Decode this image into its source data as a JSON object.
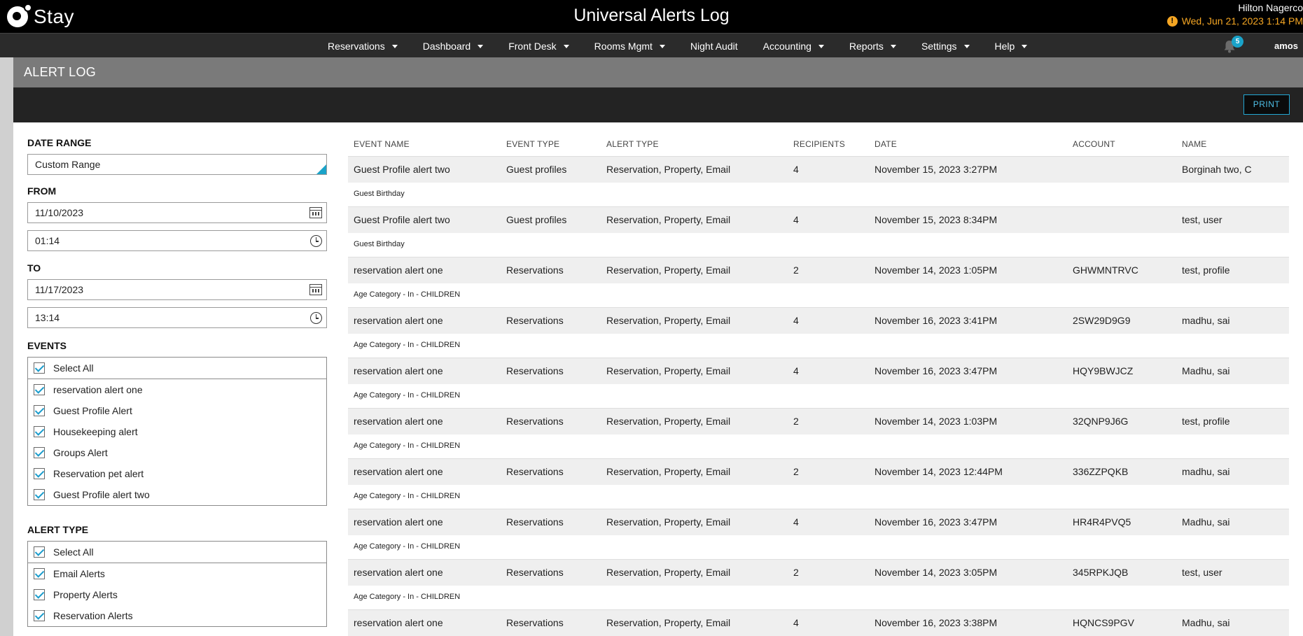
{
  "app": {
    "logo_text": "Stay",
    "title": "Universal Alerts Log",
    "hotel_name": "Hilton Nagerco",
    "datetime": "Wed, Jun 21, 2023 1:14 PM",
    "colors": {
      "accent": "#1aa3c9",
      "warning": "#f5a623"
    }
  },
  "nav": {
    "items": [
      {
        "label": "Reservations",
        "dropdown": true
      },
      {
        "label": "Dashboard",
        "dropdown": true
      },
      {
        "label": "Front Desk",
        "dropdown": true
      },
      {
        "label": "Rooms Mgmt",
        "dropdown": true
      },
      {
        "label": "Night Audit",
        "dropdown": false
      },
      {
        "label": "Accounting",
        "dropdown": true
      },
      {
        "label": "Reports",
        "dropdown": true
      },
      {
        "label": "Settings",
        "dropdown": true
      },
      {
        "label": "Help",
        "dropdown": true
      }
    ],
    "notification_count": "5",
    "user": "amos"
  },
  "page": {
    "title": "ALERT LOG",
    "print_label": "PRINT"
  },
  "filters": {
    "date_range_label": "DATE RANGE",
    "date_range_value": "Custom Range",
    "from_label": "FROM",
    "from_date": "11/10/2023",
    "from_time": "01:14",
    "to_label": "TO",
    "to_date": "11/17/2023",
    "to_time": "13:14",
    "events_label": "EVENTS",
    "events_select_all": "Select All",
    "events": [
      "reservation alert one",
      "Guest Profile Alert",
      "Housekeeping alert",
      "Groups Alert",
      "Reservation pet alert",
      "Guest Profile alert two"
    ],
    "alert_type_label": "ALERT TYPE",
    "alert_type_select_all": "Select All",
    "alert_types": [
      "Email Alerts",
      "Property Alerts",
      "Reservation Alerts"
    ]
  },
  "table": {
    "headers": [
      "EVENT NAME",
      "EVENT TYPE",
      "ALERT TYPE",
      "RECIPIENTS",
      "DATE",
      "ACCOUNT",
      "NAME"
    ],
    "rows": [
      {
        "event_name": "Guest Profile alert two",
        "event_type": "Guest profiles",
        "alert_type": "Reservation, Property, Email",
        "recipients": "4",
        "date": "November 15, 2023 3:27PM",
        "account": "",
        "name": "Borginah two, C",
        "detail": "Guest Birthday"
      },
      {
        "event_name": "Guest Profile alert two",
        "event_type": "Guest profiles",
        "alert_type": "Reservation, Property, Email",
        "recipients": "4",
        "date": "November 15, 2023 8:34PM",
        "account": "",
        "name": "test, user",
        "detail": "Guest Birthday"
      },
      {
        "event_name": "reservation alert one",
        "event_type": "Reservations",
        "alert_type": "Reservation, Property, Email",
        "recipients": "2",
        "date": "November 14, 2023 1:05PM",
        "account": "GHWMNTRVC",
        "name": "test, profile",
        "detail": "Age Category - In - CHILDREN"
      },
      {
        "event_name": "reservation alert one",
        "event_type": "Reservations",
        "alert_type": "Reservation, Property, Email",
        "recipients": "4",
        "date": "November 16, 2023 3:41PM",
        "account": "2SW29D9G9",
        "name": "madhu, sai",
        "detail": "Age Category - In - CHILDREN"
      },
      {
        "event_name": "reservation alert one",
        "event_type": "Reservations",
        "alert_type": "Reservation, Property, Email",
        "recipients": "4",
        "date": "November 16, 2023 3:47PM",
        "account": "HQY9BWJCZ",
        "name": "Madhu, sai",
        "detail": "Age Category - In - CHILDREN"
      },
      {
        "event_name": "reservation alert one",
        "event_type": "Reservations",
        "alert_type": "Reservation, Property, Email",
        "recipients": "2",
        "date": "November 14, 2023 1:03PM",
        "account": "32QNP9J6G",
        "name": "test, profile",
        "detail": "Age Category - In - CHILDREN"
      },
      {
        "event_name": "reservation alert one",
        "event_type": "Reservations",
        "alert_type": "Reservation, Property, Email",
        "recipients": "2",
        "date": "November 14, 2023 12:44PM",
        "account": "336ZZPQKB",
        "name": "madhu, sai",
        "detail": "Age Category - In - CHILDREN"
      },
      {
        "event_name": "reservation alert one",
        "event_type": "Reservations",
        "alert_type": "Reservation, Property, Email",
        "recipients": "4",
        "date": "November 16, 2023 3:47PM",
        "account": "HR4R4PVQ5",
        "name": "Madhu, sai",
        "detail": "Age Category - In - CHILDREN"
      },
      {
        "event_name": "reservation alert one",
        "event_type": "Reservations",
        "alert_type": "Reservation, Property, Email",
        "recipients": "2",
        "date": "November 14, 2023 3:05PM",
        "account": "345RPKJQB",
        "name": "test, user",
        "detail": "Age Category - In - CHILDREN"
      },
      {
        "event_name": "reservation alert one",
        "event_type": "Reservations",
        "alert_type": "Reservation, Property, Email",
        "recipients": "4",
        "date": "November 16, 2023 3:38PM",
        "account": "HQNCS9PGV",
        "name": "Madhu, sai",
        "detail": ""
      }
    ]
  }
}
